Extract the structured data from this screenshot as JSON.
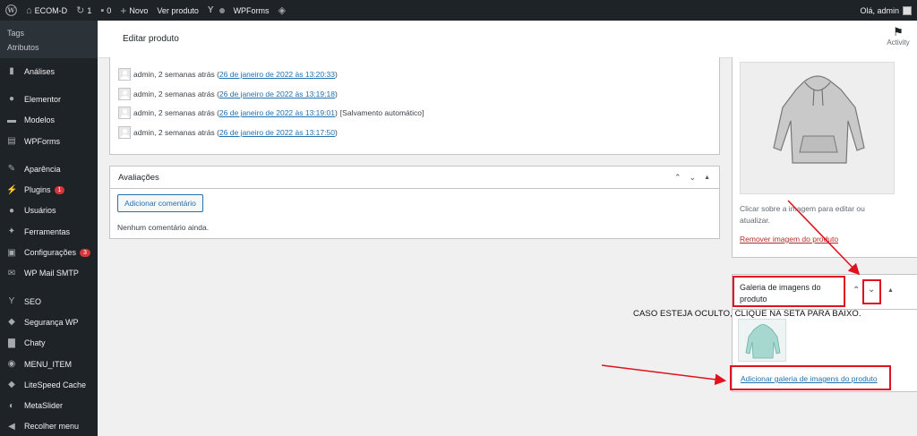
{
  "adminbar": {
    "site_name": "ECOM-D",
    "updates_count": "1",
    "comments_count": "0",
    "new_label": "Novo",
    "view_product": "Ver produto",
    "wpforms": "WPForms",
    "greeting": "Olá, admin"
  },
  "sidebar": {
    "submenu": [
      "Tags",
      "Atributos"
    ],
    "items": [
      {
        "label": "Análises",
        "icon": "bar-chart-icon",
        "glyph": "▮"
      },
      {
        "label": "Elementor",
        "icon": "elementor-icon",
        "glyph": "●"
      },
      {
        "label": "Modelos",
        "icon": "folder-icon",
        "glyph": "▬"
      },
      {
        "label": "WPForms",
        "icon": "wpforms-icon",
        "glyph": "▤"
      },
      {
        "label": "Aparência",
        "icon": "brush-icon",
        "glyph": "✎"
      },
      {
        "label": "Plugins",
        "icon": "plugin-icon",
        "glyph": "⚡",
        "badge": "1"
      },
      {
        "label": "Usuários",
        "icon": "users-icon",
        "glyph": "●"
      },
      {
        "label": "Ferramentas",
        "icon": "wrench-icon",
        "glyph": "✦"
      },
      {
        "label": "Configurações",
        "icon": "settings-icon",
        "glyph": "▣",
        "badge": "3"
      },
      {
        "label": "WP Mail SMTP",
        "icon": "mail-icon",
        "glyph": "✉"
      },
      {
        "label": "SEO",
        "icon": "yoast-icon",
        "glyph": "Y"
      },
      {
        "label": "Segurança WP",
        "icon": "shield-icon",
        "glyph": "◆"
      },
      {
        "label": "Chaty",
        "icon": "chat-icon",
        "glyph": "▇"
      },
      {
        "label": "MENU_ITEM",
        "icon": "eye-icon",
        "glyph": "◉"
      },
      {
        "label": "LiteSpeed Cache",
        "icon": "litespeed-icon",
        "glyph": "◆"
      },
      {
        "label": "MetaSlider",
        "icon": "metaslider-icon",
        "glyph": "◐"
      },
      {
        "label": "Recolher menu",
        "icon": "collapse-icon",
        "glyph": "◀"
      }
    ]
  },
  "page": {
    "title": "Editar produto",
    "activity": "Activity"
  },
  "revisions": [
    {
      "author": "admin, 2 semanas atrás",
      "date": "26 de janeiro de 2022 às 13:20:33",
      "note": ""
    },
    {
      "author": "admin, 2 semanas atrás",
      "date": "26 de janeiro de 2022 às 13:19:18",
      "note": ""
    },
    {
      "author": "admin, 2 semanas atrás",
      "date": "26 de janeiro de 2022 às 13:19:01",
      "note": "[Salvamento automático]"
    },
    {
      "author": "admin, 2 semanas atrás",
      "date": "26 de janeiro de 2022 às 13:17:50",
      "note": ""
    }
  ],
  "reviews": {
    "title": "Avaliações",
    "add_button": "Adicionar comentário",
    "empty": "Nenhum comentário ainda."
  },
  "product_image": {
    "hint": "Clicar sobre a imagem para editar ou atualizar.",
    "remove_link": "Remover imagem do produto"
  },
  "gallery": {
    "title": "Galeria de imagens do produto",
    "add_link": "Adicionar galeria de imagens do produto"
  },
  "annotation": {
    "note": "CASO ESTEJA OCULTO, CLIQUE NA SETA PARA BAIXO."
  },
  "colors": {
    "admin_dark": "#1d2327",
    "link": "#2271b1",
    "remove_red": "#b32d2e",
    "callout_red": "#e0121d",
    "badge": "#d63638"
  }
}
